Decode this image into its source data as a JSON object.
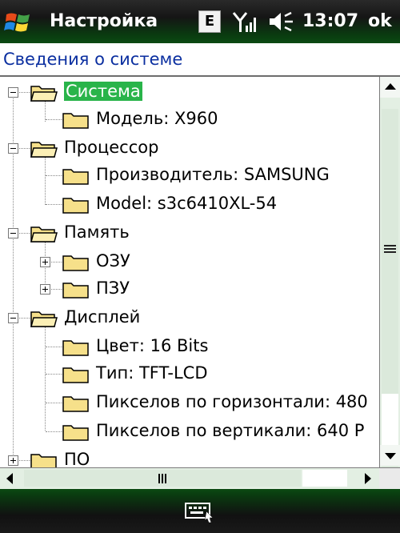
{
  "titlebar": {
    "title": "Настройка",
    "network_badge": "E",
    "time": "13:07",
    "ok_label": "ok"
  },
  "header": {
    "title": "Сведения о системе"
  },
  "tree": {
    "items": [
      {
        "label": "Система",
        "level": 0,
        "expander": "minus",
        "selected": true
      },
      {
        "label": "Модель: X960",
        "level": 1
      },
      {
        "label": "Процессор",
        "level": 0,
        "expander": "minus"
      },
      {
        "label": "Производитель: SAMSUNG",
        "level": 1
      },
      {
        "label": "Model:  s3c6410XL-54",
        "level": 1
      },
      {
        "label": "Память",
        "level": 0,
        "expander": "minus"
      },
      {
        "label": "ОЗУ",
        "level": 1,
        "expander": "plus"
      },
      {
        "label": "ПЗУ",
        "level": 1,
        "expander": "plus"
      },
      {
        "label": "Дисплей",
        "level": 0,
        "expander": "minus"
      },
      {
        "label": "Цвет: 16 Bits",
        "level": 1
      },
      {
        "label": "Тип: TFT-LCD",
        "level": 1
      },
      {
        "label": "Пикселов по горизонтали: 480",
        "level": 1
      },
      {
        "label": "Пикселов по вертикали: 640 P",
        "level": 1
      },
      {
        "label": "ПО",
        "level": 0,
        "expander": "plus"
      }
    ]
  },
  "icons": {
    "start": "windows-start-icon",
    "signal": "signal-strength-icon",
    "volume": "volume-icon",
    "folder": "folder-icon",
    "keyboard": "keyboard-input-icon"
  },
  "colors": {
    "selection": "#29b44a",
    "header_text": "#0b2fa0",
    "folder": "#f6e08a"
  }
}
